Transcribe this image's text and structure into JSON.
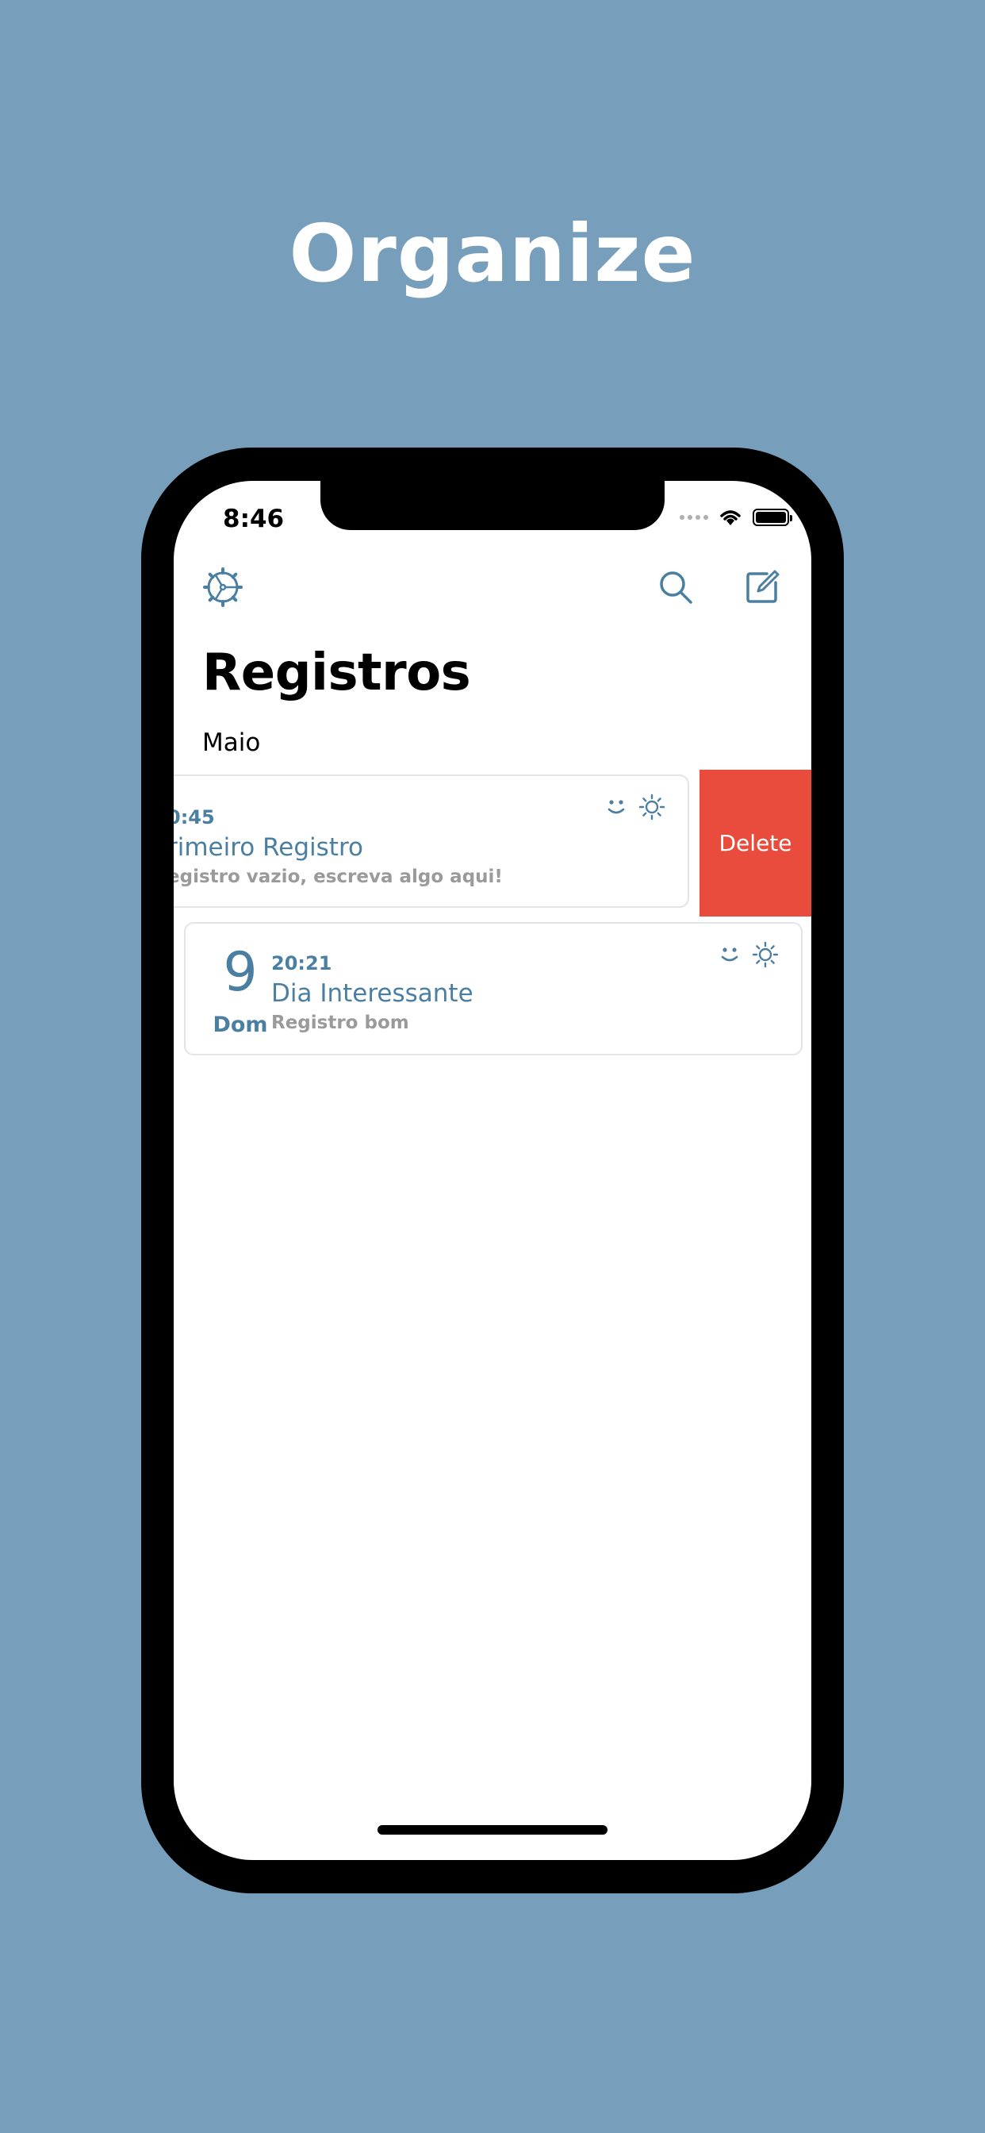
{
  "headline": "Organize",
  "status_bar": {
    "time": "8:46"
  },
  "nav": {
    "title": "Registros",
    "section": "Maio"
  },
  "entries": [
    {
      "time": "0:45",
      "title": "rimeiro Registro",
      "preview": "egistro vazio, escreva algo aqui!",
      "icons": [
        "smile-icon",
        "sun-icon"
      ]
    },
    {
      "day_number": "9",
      "day_name": "Dom",
      "time": "20:21",
      "title": "Dia Interessante",
      "preview": "Registro bom",
      "icons": [
        "smile-icon",
        "sun-icon"
      ]
    }
  ],
  "swipe_action": {
    "label": "Delete",
    "color": "#e94c3d"
  },
  "colors": {
    "background": "#779fbb",
    "accent": "#4b7fa1"
  }
}
